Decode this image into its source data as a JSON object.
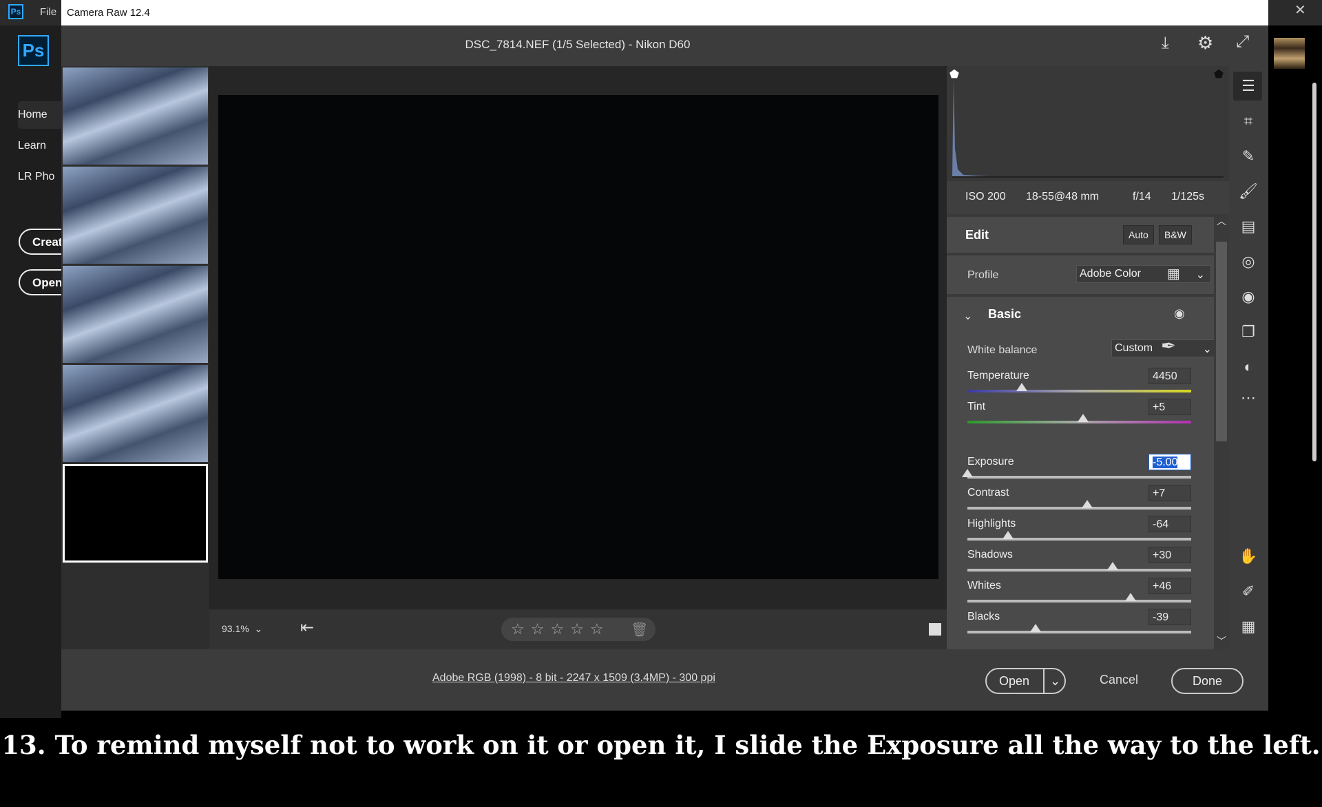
{
  "ps": {
    "menu_file": "File",
    "logo": "Ps",
    "nav": [
      "Home",
      "Learn",
      "LR Pho"
    ],
    "buttons": [
      "Creat",
      "Open"
    ]
  },
  "window": {
    "title": "Camera Raw 12.4",
    "filename": "DSC_7814.NEF (1/5 Selected)  -  Nikon D60"
  },
  "meta": {
    "iso": "ISO 200",
    "lens": "18-55@48 mm",
    "aperture": "f/14",
    "shutter": "1/125s"
  },
  "edit": {
    "title": "Edit",
    "auto": "Auto",
    "bw": "B&W",
    "profile_label": "Profile",
    "profile_value": "Adobe Color",
    "basic": "Basic",
    "wb_label": "White balance",
    "wb_value": "Custom"
  },
  "sliders": [
    {
      "label": "Temperature",
      "value": "4450",
      "pos": 0.243,
      "track": "temp"
    },
    {
      "label": "Tint",
      "value": "+5",
      "pos": 0.517,
      "track": "tint"
    },
    {
      "label": "Exposure",
      "value": "-5.00",
      "pos": 0.0,
      "track": "plain",
      "active": true
    },
    {
      "label": "Contrast",
      "value": "+7",
      "pos": 0.535,
      "track": "plain"
    },
    {
      "label": "Highlights",
      "value": "-64",
      "pos": 0.18,
      "track": "plain"
    },
    {
      "label": "Shadows",
      "value": "+30",
      "pos": 0.65,
      "track": "plain"
    },
    {
      "label": "Whites",
      "value": "+46",
      "pos": 0.73,
      "track": "plain"
    },
    {
      "label": "Blacks",
      "value": "-39",
      "pos": 0.305,
      "track": "plain"
    }
  ],
  "toolbar": {
    "zoom": "93.1%",
    "stars": 5
  },
  "footer": {
    "info": "Adobe RGB (1998) - 8 bit - 2247 x 1509 (3.4MP) - 300 ppi",
    "open": "Open",
    "cancel": "Cancel",
    "done": "Done"
  },
  "caption": "13. To remind myself not to work on it or open it, I slide the Exposure all the way to the left.",
  "colors": {
    "accent": "#31a8ff",
    "selection": "#1f5fd1"
  }
}
